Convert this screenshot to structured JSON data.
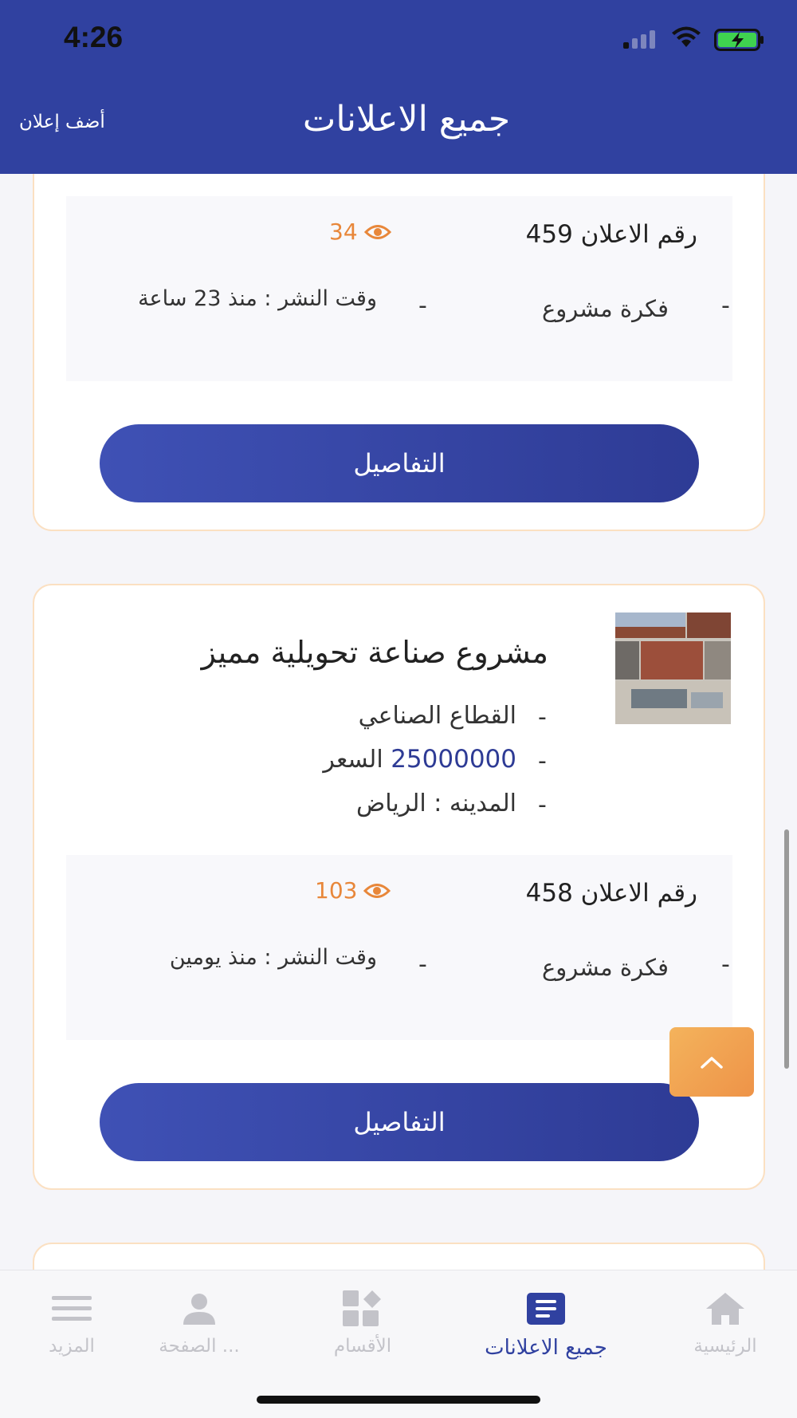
{
  "status_bar": {
    "time": "4:26"
  },
  "header": {
    "title": "جميع الاعلانات",
    "add_ad_label": "أضف إعلان"
  },
  "listings": [
    {
      "ad_number": "رقم الاعلان 459",
      "views": "34",
      "category": "فكرة مشروع",
      "posted": "وقت النشر : منذ 23 ساعة",
      "details_label": "التفاصيل"
    },
    {
      "title": "مشروع صناعة تحويلية مميز",
      "sector": "القطاع الصناعي",
      "price_value": "25000000",
      "price_label": "السعر",
      "city": "المدينه : الرياض",
      "ad_number": "رقم الاعلان 458",
      "views": "103",
      "category": "فكرة مشروع",
      "posted": "وقت النشر : منذ يومين",
      "details_label": "التفاصيل"
    }
  ],
  "bullet": "-",
  "tabbar": {
    "items": [
      {
        "label": "المزيد",
        "icon": "menu-icon",
        "active": false
      },
      {
        "label": "الصفحة ...",
        "icon": "user-icon",
        "active": false
      },
      {
        "label": "الأقسام",
        "icon": "categories-icon",
        "active": false
      },
      {
        "label": "جميع الاعلانات",
        "icon": "list-icon",
        "active": true
      },
      {
        "label": "الرئيسية",
        "icon": "home-icon",
        "active": false
      }
    ]
  },
  "colors": {
    "primary": "#3041a0",
    "accent_orange": "#e8873a",
    "card_border": "#fbe0c2",
    "inactive_tab": "#c3c3c9"
  }
}
